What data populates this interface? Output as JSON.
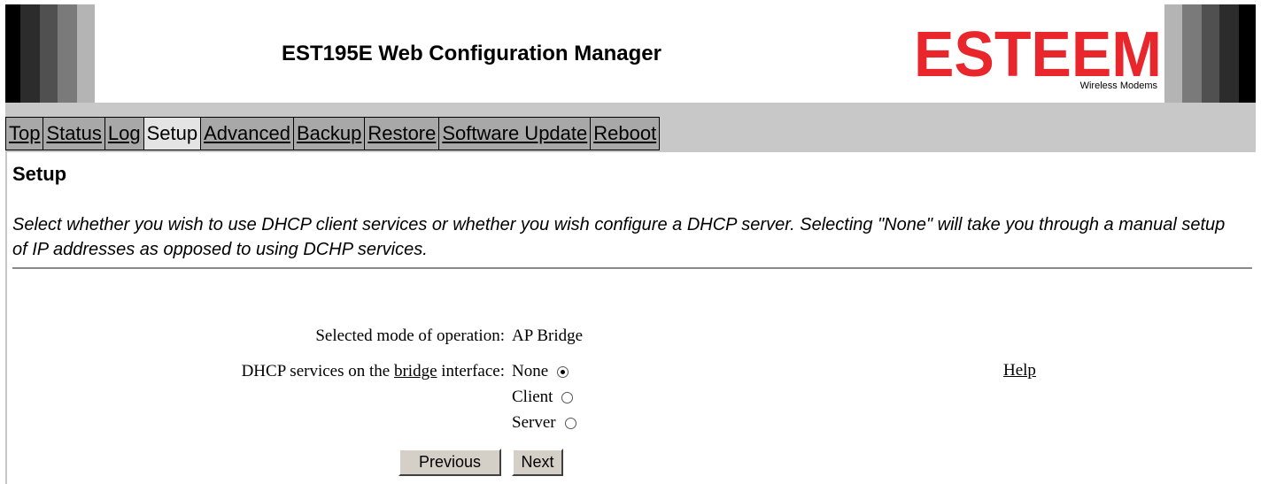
{
  "header": {
    "title": "EST195E Web Configuration Manager",
    "logo": {
      "name": "ESTEEM",
      "tagline": "Wireless Modems",
      "color": "#e8262c"
    }
  },
  "nav": {
    "tabs": [
      {
        "label": "Top",
        "active": false
      },
      {
        "label": "Status",
        "active": false
      },
      {
        "label": "Log",
        "active": false
      },
      {
        "label": "Setup",
        "active": true
      },
      {
        "label": "Advanced",
        "active": false
      },
      {
        "label": "Backup",
        "active": false
      },
      {
        "label": "Restore",
        "active": false
      },
      {
        "label": "Software Update",
        "active": false
      },
      {
        "label": "Reboot",
        "active": false
      }
    ]
  },
  "page": {
    "heading": "Setup",
    "intro": "Select whether you wish to use DHCP client services or whether you wish configure a DHCP server. Selecting \"None\" will take you through a manual setup of IP addresses as opposed to using DCHP services."
  },
  "form": {
    "mode_label": "Selected mode of operation:",
    "mode_value": "AP Bridge",
    "dhcp_label_pre": "DHCP services on the",
    "dhcp_label_link": "bridge",
    "dhcp_label_post": "interface:",
    "options": [
      {
        "label": "None",
        "checked": true
      },
      {
        "label": "Client",
        "checked": false
      },
      {
        "label": "Server",
        "checked": false
      }
    ],
    "help": "Help",
    "previous": "Previous",
    "next": "Next"
  }
}
